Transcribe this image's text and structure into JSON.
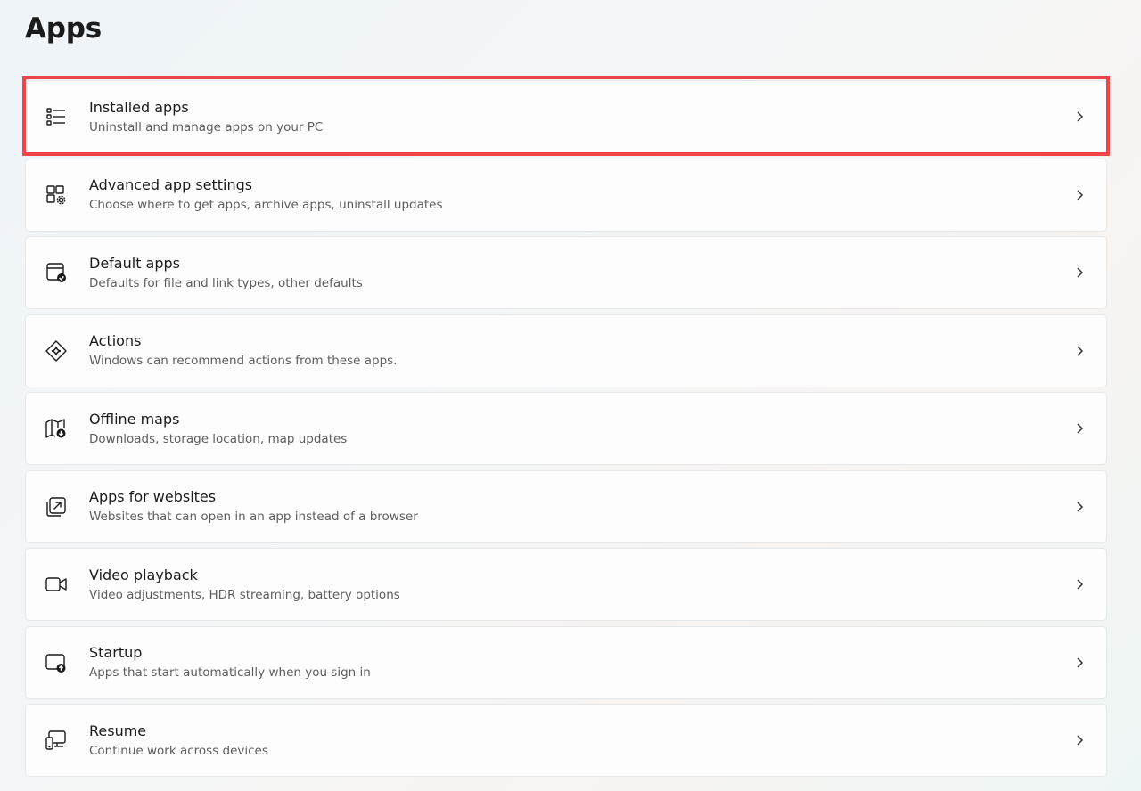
{
  "page": {
    "title": "Apps"
  },
  "items": [
    {
      "title": "Installed apps",
      "subtitle": "Uninstall and manage apps on your PC",
      "icon": "list-icon",
      "highlighted": true
    },
    {
      "title": "Advanced app settings",
      "subtitle": "Choose where to get apps, archive apps, uninstall updates",
      "icon": "grid-gear-icon"
    },
    {
      "title": "Default apps",
      "subtitle": "Defaults for file and link types, other defaults",
      "icon": "window-check-icon"
    },
    {
      "title": "Actions",
      "subtitle": "Windows can recommend actions from these apps.",
      "icon": "sparkle-diamond-icon"
    },
    {
      "title": "Offline maps",
      "subtitle": "Downloads, storage location, map updates",
      "icon": "map-download-icon"
    },
    {
      "title": "Apps for websites",
      "subtitle": "Websites that can open in an app instead of a browser",
      "icon": "open-in-app-icon"
    },
    {
      "title": "Video playback",
      "subtitle": "Video adjustments, HDR streaming, battery options",
      "icon": "video-camera-icon"
    },
    {
      "title": "Startup",
      "subtitle": "Apps that start automatically when you sign in",
      "icon": "window-upload-icon"
    },
    {
      "title": "Resume",
      "subtitle": "Continue work across devices",
      "icon": "devices-icon"
    }
  ],
  "colors": {
    "highlight": "#f0434a",
    "card_bg": "#fdfdfd",
    "card_border": "#e6e8ea",
    "title": "#1b1b1b",
    "subtitle": "#5d5d5d"
  }
}
